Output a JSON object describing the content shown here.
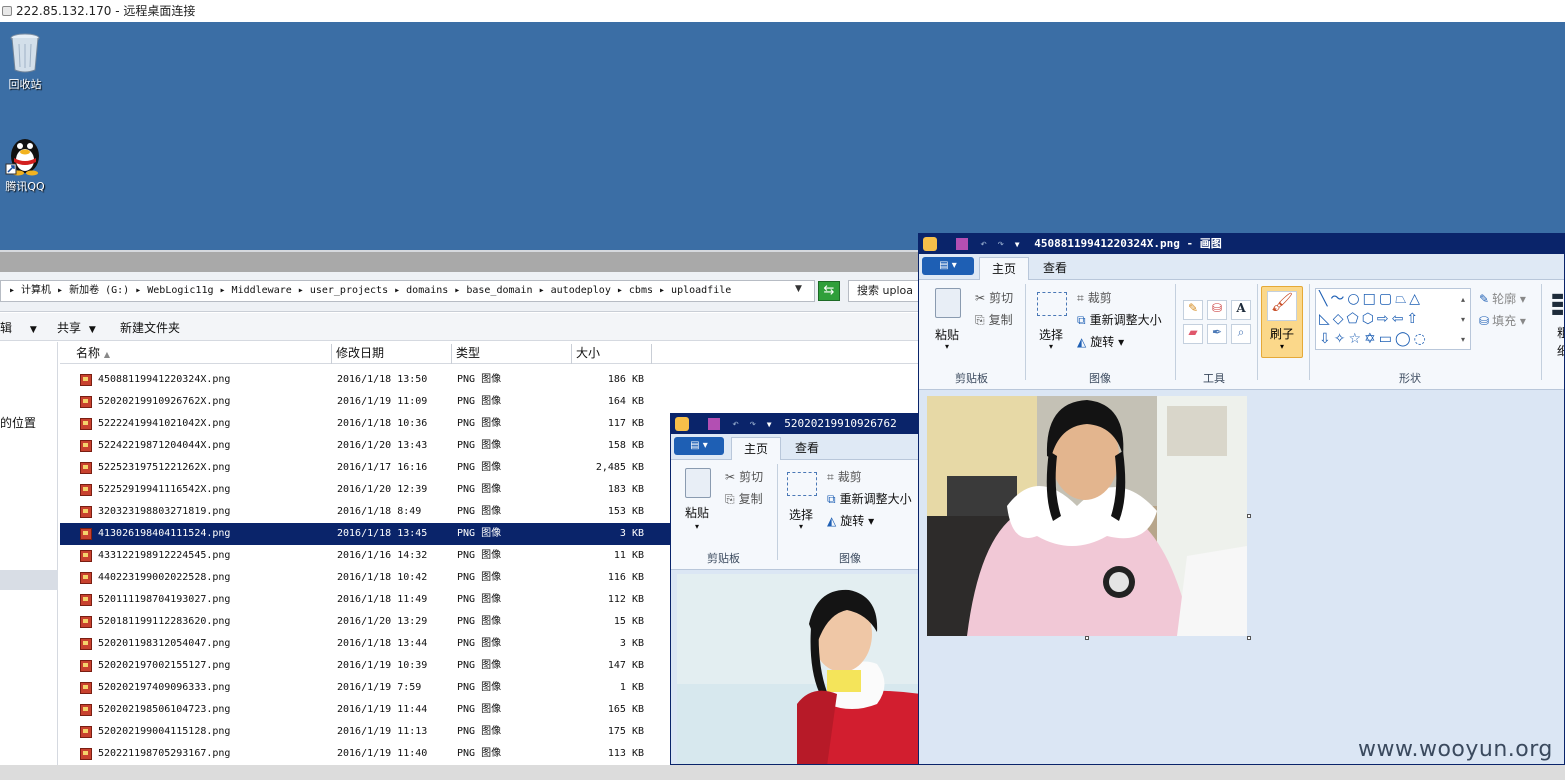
{
  "rdp": {
    "title": "222.85.132.170 - 远程桌面连接"
  },
  "desktop": {
    "icons": [
      {
        "label": "回收站",
        "icon": "recycle-bin-icon"
      },
      {
        "label": "腾讯QQ",
        "icon": "qq-penguin-icon"
      }
    ]
  },
  "explorer": {
    "address": "▸ 计算机 ▸ 新加卷 (G:) ▸ WebLogic11g ▸ Middleware ▸ user_projects ▸ domains ▸ base_domain ▸ autodeploy ▸ cbms ▸ uploadfile",
    "search_placeholder": "搜索 uploa",
    "toolbar": {
      "edit": "辑",
      "share": "共享",
      "new_folder": "新建文件夹"
    },
    "nav_location": "的位置",
    "columns": {
      "name": "名称",
      "date": "修改日期",
      "type": "类型",
      "size": "大小"
    },
    "files": [
      {
        "name": "45088119941220324X.png",
        "date": "2016/1/18 13:50",
        "type": "PNG 图像",
        "size": "186 KB"
      },
      {
        "name": "52020219910926762X.png",
        "date": "2016/1/19 11:09",
        "type": "PNG 图像",
        "size": "164 KB"
      },
      {
        "name": "52222419941021042X.png",
        "date": "2016/1/18 10:36",
        "type": "PNG 图像",
        "size": "117 KB"
      },
      {
        "name": "52242219871204044X.png",
        "date": "2016/1/20 13:43",
        "type": "PNG 图像",
        "size": "158 KB"
      },
      {
        "name": "52252319751221262X.png",
        "date": "2016/1/17 16:16",
        "type": "PNG 图像",
        "size": "2,485 KB"
      },
      {
        "name": "52252919941116542X.png",
        "date": "2016/1/20 12:39",
        "type": "PNG 图像",
        "size": "183 KB"
      },
      {
        "name": "320323198803271819.png",
        "date": "2016/1/18 8:49",
        "type": "PNG 图像",
        "size": "153 KB"
      },
      {
        "name": "413026198404111524.png",
        "date": "2016/1/18 13:45",
        "type": "PNG 图像",
        "size": "3 KB",
        "selected": true
      },
      {
        "name": "433122198912224545.png",
        "date": "2016/1/16 14:32",
        "type": "PNG 图像",
        "size": "11 KB"
      },
      {
        "name": "440223199002022528.png",
        "date": "2016/1/18 10:42",
        "type": "PNG 图像",
        "size": "116 KB"
      },
      {
        "name": "520111198704193027.png",
        "date": "2016/1/18 11:49",
        "type": "PNG 图像",
        "size": "112 KB"
      },
      {
        "name": "520181199112283620.png",
        "date": "2016/1/20 13:29",
        "type": "PNG 图像",
        "size": "15 KB"
      },
      {
        "name": "520201198312054047.png",
        "date": "2016/1/18 13:44",
        "type": "PNG 图像",
        "size": "3 KB"
      },
      {
        "name": "520202197002155127.png",
        "date": "2016/1/19 10:39",
        "type": "PNG 图像",
        "size": "147 KB"
      },
      {
        "name": "520202197409096333.png",
        "date": "2016/1/19 7:59",
        "type": "PNG 图像",
        "size": "1 KB"
      },
      {
        "name": "520202198506104723.png",
        "date": "2016/1/19 11:44",
        "type": "PNG 图像",
        "size": "165 KB"
      },
      {
        "name": "520202199004115128.png",
        "date": "2016/1/19 11:13",
        "type": "PNG 图像",
        "size": "175 KB"
      },
      {
        "name": "520221198705293167.png",
        "date": "2016/1/19 11:40",
        "type": "PNG 图像",
        "size": "113 KB"
      }
    ]
  },
  "paint_back": {
    "title": "52020219910926762",
    "tab_home": "主页",
    "tab_view": "查看",
    "paste": "粘贴",
    "cut": "剪切",
    "copy": "复制",
    "select": "选择",
    "crop": "裁剪",
    "resize": "重新调整大小",
    "rotate": "旋转",
    "group_clipboard": "剪贴板",
    "group_image": "图像"
  },
  "paint_front": {
    "title": "45088119941220324X.png - 画图",
    "tab_home": "主页",
    "tab_view": "查看",
    "paste": "粘贴",
    "cut": "剪切",
    "copy": "复制",
    "select": "选择",
    "crop": "裁剪",
    "resize": "重新调整大小",
    "rotate": "旋转",
    "brush": "刷子",
    "outline": "轮廓",
    "fill": "填充",
    "size_partial": "粗",
    "size_partial2": "细",
    "group_clipboard": "剪贴板",
    "group_image": "图像",
    "group_tools": "工具",
    "group_shapes": "形状"
  },
  "watermark": "www.wooyun.org",
  "colors": {
    "desktop": "#3b6ea5",
    "selection": "#0a246a",
    "paint_bg": "#dbe6f4"
  }
}
